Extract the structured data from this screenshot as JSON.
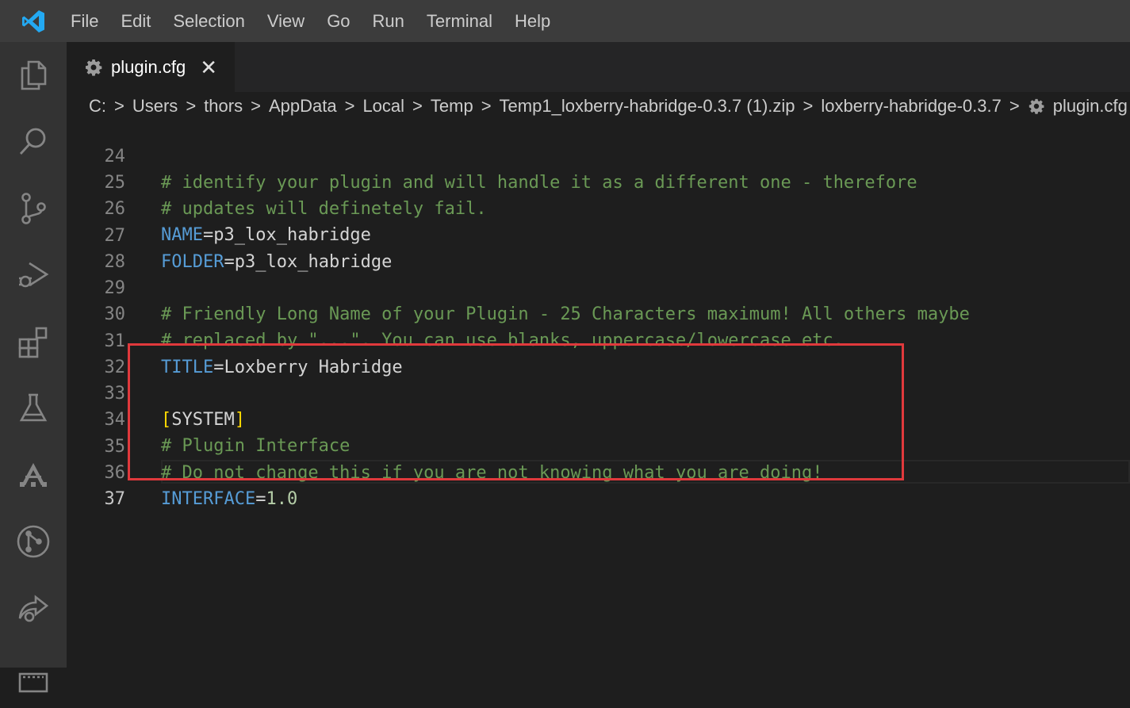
{
  "menu": {
    "items": [
      "File",
      "Edit",
      "Selection",
      "View",
      "Go",
      "Run",
      "Terminal",
      "Help"
    ]
  },
  "activity_bar": {
    "icons": [
      "files-icon",
      "search-icon",
      "source-control-icon",
      "run-debug-icon",
      "extensions-icon",
      "testing-icon",
      "tree-icon",
      "git-graph-icon",
      "live-share-icon"
    ]
  },
  "tab": {
    "label": "plugin.cfg",
    "close": "✕"
  },
  "breadcrumb": {
    "parts": [
      "C:",
      "Users",
      "thors",
      "AppData",
      "Local",
      "Temp",
      "Temp1_loxberry-habridge-0.3.7 (1).zip",
      "loxberry-habridge-0.3.7"
    ],
    "file": "plugin.cfg",
    "separator": ">"
  },
  "editor": {
    "lines": [
      {
        "n": "24",
        "comment": "# identify your plugin and will handle it as a different one - therefore"
      },
      {
        "n": "25",
        "comment": "# updates will definetely fail."
      },
      {
        "n": "26",
        "key": "NAME",
        "value": "p3_lox_habridge"
      },
      {
        "n": "27",
        "key": "FOLDER",
        "value": "p3_lox_habridge"
      },
      {
        "n": "28"
      },
      {
        "n": "29",
        "comment": "# Friendly Long Name of your Plugin - 25 Characters maximum! All others maybe"
      },
      {
        "n": "30",
        "comment": "# replaced by \"...\". You can use blanks, uppercase/lowercase etc."
      },
      {
        "n": "31",
        "key": "TITLE",
        "value": "Loxberry Habridge"
      },
      {
        "n": "32"
      },
      {
        "n": "33",
        "section": "SYSTEM"
      },
      {
        "n": "34",
        "comment": "# Plugin Interface"
      },
      {
        "n": "35",
        "comment": "# Do not change this if you are not knowing what you are doing!"
      },
      {
        "n": "36",
        "key": "INTERFACE",
        "number": "1.0"
      },
      {
        "n": "37",
        "active": true
      }
    ]
  },
  "colors": {
    "accent_highlight": "#e0393c",
    "comment": "#6a9955",
    "key": "#569cd6",
    "number": "#b5cea8",
    "bracket": "#ffd700"
  }
}
